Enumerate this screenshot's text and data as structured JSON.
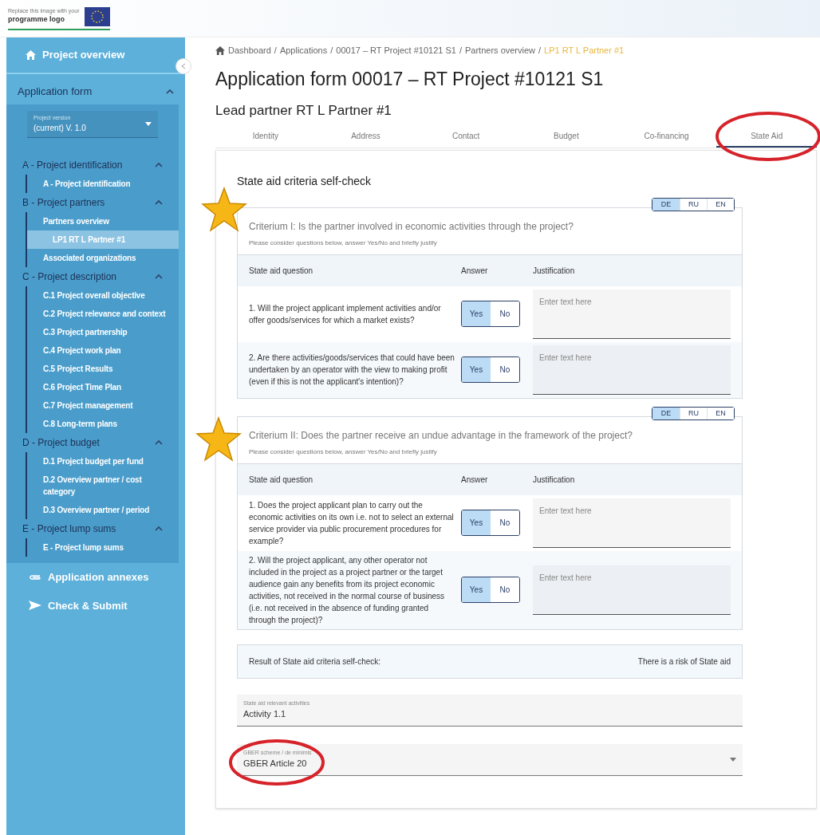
{
  "logo": {
    "caption": "Replace this image with your",
    "name": "programme logo"
  },
  "sidebar": {
    "project_overview": "Project overview",
    "application_form": {
      "title": "Application form",
      "expanded": true,
      "version": {
        "label": "Project version",
        "value": "(current) V. 1.0"
      },
      "sections": [
        {
          "title": "A - Project identification",
          "expanded": true,
          "children": [
            {
              "label": "A - Project identification",
              "selected": false
            }
          ]
        },
        {
          "title": "B - Project partners",
          "expanded": true,
          "children": [
            {
              "label": "Partners overview",
              "selected": false,
              "children": [
                {
                  "label": "LP1 RT L Partner #1",
                  "selected": true
                }
              ]
            },
            {
              "label": "Associated organizations",
              "selected": false
            }
          ]
        },
        {
          "title": "C - Project description",
          "expanded": true,
          "children": [
            {
              "label": "C.1 Project overall objective",
              "selected": false
            },
            {
              "label": "C.2 Project relevance and context",
              "selected": false
            },
            {
              "label": "C.3 Project partnership",
              "selected": false
            },
            {
              "label": "C.4 Project work plan",
              "selected": false
            },
            {
              "label": "C.5 Project Results",
              "selected": false
            },
            {
              "label": "C.6 Project Time Plan",
              "selected": false
            },
            {
              "label": "C.7 Project management",
              "selected": false
            },
            {
              "label": "C.8 Long-term plans",
              "selected": false
            }
          ]
        },
        {
          "title": "D - Project budget",
          "expanded": true,
          "children": [
            {
              "label": "D.1 Project budget per fund",
              "selected": false
            },
            {
              "label": "D.2 Overview partner / cost category",
              "selected": false
            },
            {
              "label": "D.3 Overview partner / period",
              "selected": false
            }
          ]
        },
        {
          "title": "E - Project lump sums",
          "expanded": true,
          "children": [
            {
              "label": "E - Project lump sums",
              "selected": false
            }
          ]
        }
      ]
    },
    "links": [
      {
        "kind": "annexes",
        "label": "Application annexes"
      },
      {
        "kind": "submit",
        "label": "Check & Submit"
      }
    ]
  },
  "breadcrumb": [
    {
      "kind": "link",
      "label": "Dashboard",
      "current": false
    },
    {
      "kind": "separator",
      "label": "/"
    },
    {
      "kind": "link",
      "label": "Applications",
      "current": false
    },
    {
      "kind": "separator",
      "label": "/"
    },
    {
      "kind": "link",
      "label": "00017 – RT Project #10121 S1",
      "current": false
    },
    {
      "kind": "separator",
      "label": "/"
    },
    {
      "kind": "link",
      "label": "Partners overview",
      "current": false
    },
    {
      "kind": "separator",
      "label": "/"
    },
    {
      "kind": "link",
      "label": "LP1 RT L Partner #1",
      "current": true
    }
  ],
  "title": "Application form 00017 – RT Project #10121 S1",
  "subtitle": "Lead partner RT L Partner #1",
  "tabs": [
    {
      "label": "Identity",
      "selected": false
    },
    {
      "label": "Address",
      "selected": false
    },
    {
      "label": "Contact",
      "selected": false
    },
    {
      "label": "Budget",
      "selected": false
    },
    {
      "label": "Co-financing",
      "selected": false
    },
    {
      "label": "State Aid",
      "selected": true
    }
  ],
  "state_aid": {
    "heading": "State aid criteria self-check",
    "criteria": [
      {
        "languages": [
          {
            "label": "DE",
            "selected": true
          },
          {
            "label": "RU",
            "selected": false
          },
          {
            "label": "EN",
            "selected": false
          }
        ],
        "title": "Criterium I: Is the partner involved in economic activities through the project?",
        "hint": "Please consider questions below, answer Yes/No and briefly justify",
        "columns": [
          "State aid question",
          "Answer",
          "Justification"
        ],
        "questions": [
          {
            "text": "1. Will the project applicant implement activities and/or offer goods/services for which a market exists?",
            "options": [
              {
                "label": "Yes",
                "selected": true
              },
              {
                "label": "No",
                "selected": false
              }
            ],
            "placeholder": "Enter text here"
          },
          {
            "text": "2. Are there activities/goods/services that could have been undertaken by an operator with the view to making profit (even if this is not the applicant's intention)?",
            "options": [
              {
                "label": "Yes",
                "selected": true
              },
              {
                "label": "No",
                "selected": false
              }
            ],
            "placeholder": "Enter text here"
          }
        ]
      },
      {
        "languages": [
          {
            "label": "DE",
            "selected": true
          },
          {
            "label": "RU",
            "selected": false
          },
          {
            "label": "EN",
            "selected": false
          }
        ],
        "title": "Criterium II: Does the partner receive an undue advantage in the framework of the project?",
        "hint": "Please consider questions below, answer Yes/No and briefly justify",
        "columns": [
          "State aid question",
          "Answer",
          "Justification"
        ],
        "questions": [
          {
            "text": "1. Does the project applicant plan to carry out the economic activities on its own i.e. not to select an external service provider via public procurement procedures for example?",
            "options": [
              {
                "label": "Yes",
                "selected": true
              },
              {
                "label": "No",
                "selected": false
              }
            ],
            "placeholder": "Enter text here"
          },
          {
            "text": "2. Will the project applicant, any other operator not included in the project as a project partner or the target audience gain any benefits from its project economic activities, not received in the normal course of business (i.e. not received in the absence of funding granted through the project)?",
            "options": [
              {
                "label": "Yes",
                "selected": true
              },
              {
                "label": "No",
                "selected": false
              }
            ],
            "placeholder": "Enter text here"
          }
        ]
      }
    ],
    "result": {
      "label": "Result of State aid criteria self-check:",
      "value": "There is a risk of State aid"
    },
    "activities": {
      "label": "State aid relevant activities",
      "value": "Activity 1.1"
    },
    "scheme": {
      "label": "GBER scheme / de minimis",
      "value": "GBER Article 20"
    }
  }
}
